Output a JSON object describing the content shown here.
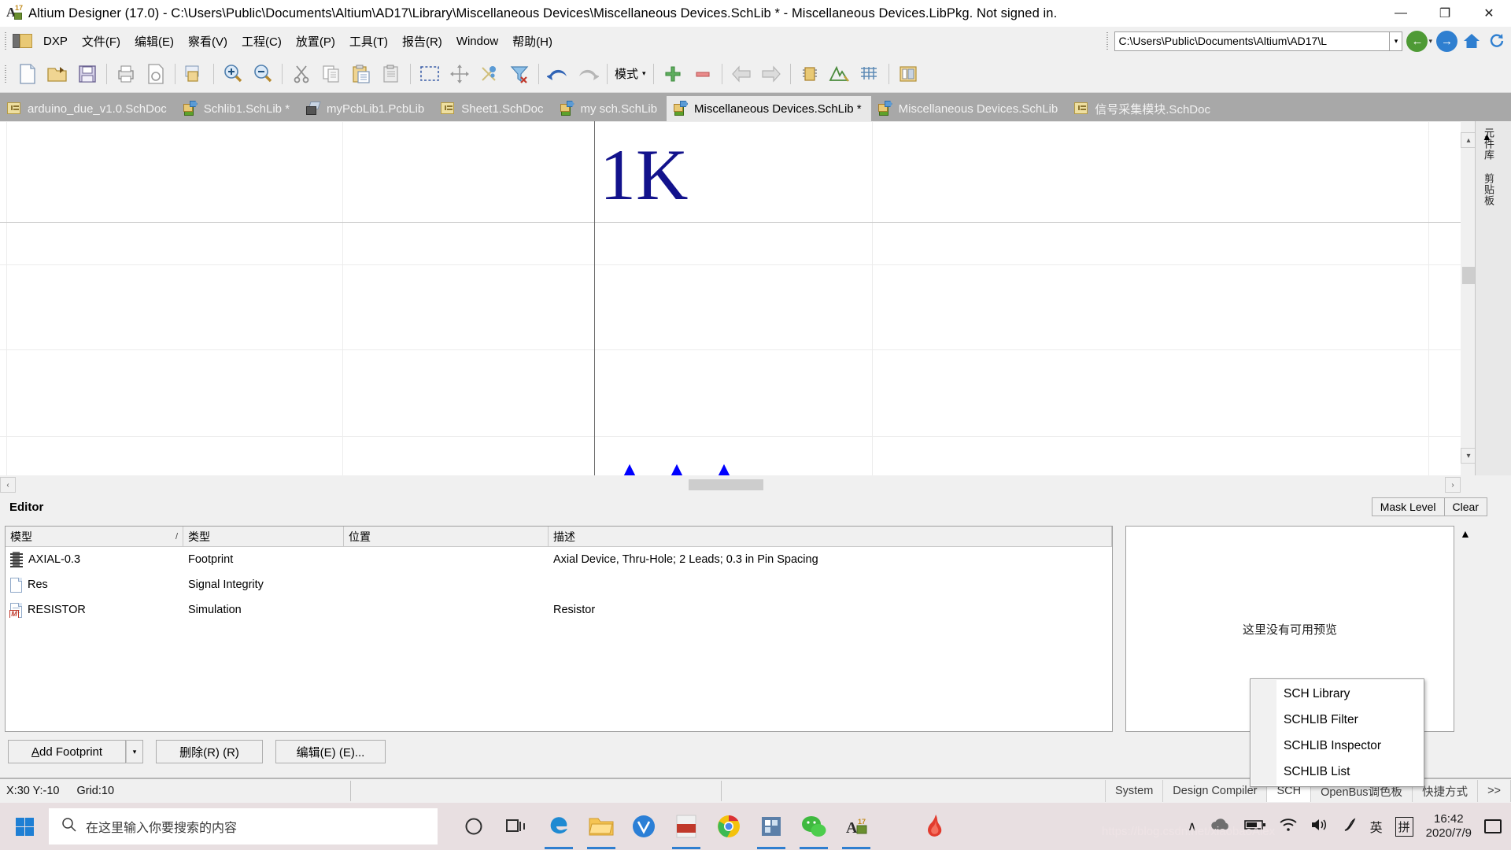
{
  "window": {
    "title": "Altium Designer (17.0) - C:\\Users\\Public\\Documents\\Altium\\AD17\\Library\\Miscellaneous Devices\\Miscellaneous Devices.SchLib * - Miscellaneous Devices.LibPkg. Not signed in.",
    "app_icon": "altium-icon",
    "minimize": "—",
    "maximize": "❐",
    "close": "✕"
  },
  "menubar": {
    "dxp_label": "DXP",
    "items": [
      "文件(F)",
      "编辑(E)",
      "察看(V)",
      "工程(C)",
      "放置(P)",
      "工具(T)",
      "报告(R)",
      "Window",
      "帮助(H)"
    ],
    "address_value": "C:\\Users\\Public\\Documents\\Altium\\AD17\\L",
    "address_caret": "▾",
    "back_icon": "back-arrow-icon",
    "forward_icon": "forward-arrow-icon",
    "home_icon": "home-icon",
    "refresh_icon": "refresh-icon"
  },
  "toolbar": {
    "mode_label": "模式",
    "mode_caret": "▾",
    "icons": [
      "new-document-icon",
      "open-folder-icon",
      "save-icon",
      "print-icon",
      "print-preview-icon",
      "open-project-icon",
      "zoom-in-icon",
      "zoom-out-icon",
      "cut-icon",
      "copy-icon",
      "paste-icon",
      "paste-special-icon",
      "select-area-icon",
      "move-icon",
      "deselect-icon",
      "clear-filter-icon",
      "undo-icon",
      "redo-icon",
      "mode-dropdown",
      "add-part-icon",
      "remove-part-icon",
      "prev-part-icon",
      "next-part-icon",
      "component-icon",
      "draw-tool-icon",
      "grid-icon",
      "library-icon"
    ]
  },
  "doc_tabs": [
    {
      "label": "arduino_due_v1.0.SchDoc",
      "icon": "schdoc-icon",
      "active": false
    },
    {
      "label": "Schlib1.SchLib *",
      "icon": "schlib-icon",
      "active": false
    },
    {
      "label": "myPcbLib1.PcbLib",
      "icon": "pcblib-icon",
      "active": false
    },
    {
      "label": "Sheet1.SchDoc",
      "icon": "schdoc-icon",
      "active": false
    },
    {
      "label": "my sch.SchLib",
      "icon": "schlib-icon",
      "active": false
    },
    {
      "label": "Miscellaneous Devices.SchLib *",
      "icon": "schlib-icon",
      "active": true
    },
    {
      "label": "Miscellaneous Devices.SchLib",
      "icon": "schlib-icon",
      "active": false
    },
    {
      "label": "信号采集模块.SchDoc",
      "icon": "schdoc-icon",
      "active": false
    }
  ],
  "canvas": {
    "component_value": "1K",
    "value_color": "#12128c",
    "resistor_color": "#0000ff",
    "wire_color": "#000000",
    "scroll_left_icon": "‹",
    "scroll_right_icon": "›",
    "scroll_up_icon": "▴",
    "scroll_down_icon": "▾"
  },
  "side_panel_tabs": [
    "元件库",
    "剪贴板"
  ],
  "editor": {
    "label": "Editor",
    "mask_level": "Mask Level",
    "clear": "Clear"
  },
  "model_table": {
    "columns": [
      "模型",
      "类型",
      "位置",
      "描述"
    ],
    "sort_mark": "/",
    "rows": [
      {
        "icon": "footprint-icon",
        "model": "AXIAL-0.3",
        "type": "Footprint",
        "location": "",
        "description": "Axial Device, Thru-Hole; 2 Leads; 0.3 in Pin Spacing"
      },
      {
        "icon": "document-icon",
        "model": "Res",
        "type": "Signal Integrity",
        "location": "",
        "description": ""
      },
      {
        "icon": "simulation-icon",
        "model": "RESISTOR",
        "type": "Simulation",
        "location": "",
        "description": "Resistor"
      }
    ]
  },
  "bottom_buttons": {
    "add_footprint": "Add Footprint",
    "add_footprint_caret": "▾",
    "delete": "删除(R) (R)",
    "edit": "编辑(E) (E)..."
  },
  "preview": {
    "empty_text": "这里没有可用预览",
    "collapse_icon": "collapse-chevron-icon"
  },
  "context_menu": {
    "items": [
      "SCH Library",
      "SCHLIB Filter",
      "SCHLIB Inspector",
      "SCHLIB List"
    ]
  },
  "statusbar": {
    "coords": "X:30 Y:-10",
    "grid": "Grid:10",
    "panel_tabs": [
      "System",
      "Design Compiler",
      "SCH",
      "OpenBus调色板",
      "快捷方式"
    ],
    "selected_panel_tab": "SCH",
    "more": ">>"
  },
  "taskbar": {
    "search_placeholder": "在这里输入你要搜索的内容",
    "search_icon": "search-icon",
    "start_icon": "windows-start-icon",
    "cortana_icon": "cortana-circle-icon",
    "taskview_icon": "task-view-icon",
    "apps": [
      "edge-icon",
      "file-explorer-icon",
      "v-app-icon",
      "pdf-app-icon",
      "chrome-icon",
      "app-icon",
      "wechat-icon",
      "altium-icon",
      "foxit-icon"
    ],
    "tray": {
      "chevron": "∧",
      "cloud_icon": "onedrive-icon",
      "battery_icon": "battery-icon",
      "wifi_icon": "wifi-icon",
      "volume_icon": "volume-icon",
      "pen_icon": "pen-icon",
      "ime_lang": "英",
      "ime_mode": "拼",
      "time": "16:42",
      "date": "2020/7/9",
      "notification_icon": "notification-icon"
    }
  },
  "watermark": "https://blog.csdn.net/xiaobaoAlex"
}
